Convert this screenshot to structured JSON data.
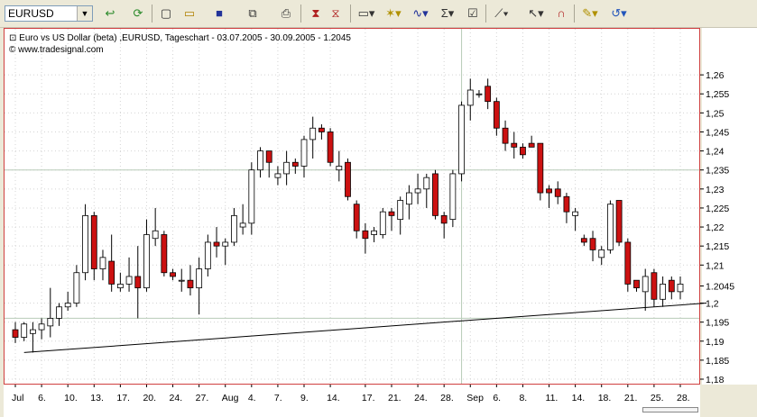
{
  "toolbar": {
    "symbol": "EURUSD",
    "buttons": [
      "go-icon",
      "refresh-icon",
      "new-icon",
      "open-icon",
      "save-icon",
      "copy-icon",
      "print-icon",
      "chart-icon",
      "chart2-icon",
      "window-icon",
      "indicator-icon",
      "study-icon",
      "sum-icon",
      "properties-icon",
      "draw-line-icon",
      "cursor-icon",
      "magnet-icon",
      "note-icon",
      "undo-icon"
    ]
  },
  "header": {
    "line1": "Euro vs US Dollar (beta) ,EURUSD, Tageschart - 03.07.2005 - 30.09.2005 - 1.2045",
    "line2": "www.tradesignal.com"
  },
  "colors": {
    "up": "#ffffff",
    "down": "#cc1111",
    "grid": "#c9c9c9",
    "frame": "#d04040"
  },
  "chart_data": {
    "type": "candlestick",
    "ylim": [
      1.18,
      1.265
    ],
    "yticks": [
      "1,26",
      "1,255",
      "1,25",
      "1,245",
      "1,24",
      "1,235",
      "1,23",
      "1,225",
      "1,22",
      "1,215",
      "1,21",
      "1.2045",
      "1,2",
      "1,195",
      "1,19",
      "1,185",
      "1,18"
    ],
    "xticks": [
      "Jul",
      "6.",
      "10.",
      "13.",
      "17.",
      "20.",
      "24.",
      "27.",
      "Aug",
      "4.",
      "7.",
      "9.",
      "14.",
      "17.",
      "21.",
      "24.",
      "28.",
      "Sep",
      "6.",
      "8.",
      "11.",
      "14.",
      "18.",
      "21.",
      "25.",
      "28."
    ],
    "last_value": "1.2045",
    "candles": [
      [
        1.193,
        1.195,
        1.1895,
        1.191
      ],
      [
        1.191,
        1.195,
        1.19,
        1.1945
      ],
      [
        1.192,
        1.195,
        1.187,
        1.193
      ],
      [
        1.193,
        1.196,
        1.1905,
        1.1945
      ],
      [
        1.194,
        1.204,
        1.191,
        1.196
      ],
      [
        1.196,
        1.2,
        1.194,
        1.199
      ],
      [
        1.199,
        1.203,
        1.198,
        1.2
      ],
      [
        1.2,
        1.21,
        1.199,
        1.208
      ],
      [
        1.208,
        1.226,
        1.206,
        1.223
      ],
      [
        1.223,
        1.224,
        1.206,
        1.209
      ],
      [
        1.209,
        1.214,
        1.206,
        1.212
      ],
      [
        1.211,
        1.218,
        1.203,
        1.205
      ],
      [
        1.204,
        1.208,
        1.203,
        1.205
      ],
      [
        1.205,
        1.212,
        1.203,
        1.207
      ],
      [
        1.207,
        1.215,
        1.196,
        1.204
      ],
      [
        1.204,
        1.222,
        1.203,
        1.218
      ],
      [
        1.217,
        1.225,
        1.215,
        1.219
      ],
      [
        1.218,
        1.219,
        1.207,
        1.208
      ],
      [
        1.208,
        1.209,
        1.206,
        1.207
      ],
      [
        1.206,
        1.209,
        1.203,
        1.206
      ],
      [
        1.206,
        1.21,
        1.202,
        1.204
      ],
      [
        1.204,
        1.212,
        1.197,
        1.209
      ],
      [
        1.209,
        1.218,
        1.207,
        1.216
      ],
      [
        1.216,
        1.22,
        1.212,
        1.215
      ],
      [
        1.215,
        1.217,
        1.21,
        1.216
      ],
      [
        1.216,
        1.225,
        1.215,
        1.223
      ],
      [
        1.22,
        1.226,
        1.218,
        1.221
      ],
      [
        1.221,
        1.237,
        1.218,
        1.235
      ],
      [
        1.235,
        1.241,
        1.233,
        1.24
      ],
      [
        1.24,
        1.24,
        1.233,
        1.237
      ],
      [
        1.233,
        1.236,
        1.231,
        1.234
      ],
      [
        1.234,
        1.24,
        1.231,
        1.237
      ],
      [
        1.237,
        1.238,
        1.234,
        1.236
      ],
      [
        1.236,
        1.244,
        1.233,
        1.243
      ],
      [
        1.243,
        1.249,
        1.238,
        1.246
      ],
      [
        1.246,
        1.247,
        1.243,
        1.245
      ],
      [
        1.245,
        1.246,
        1.236,
        1.237
      ],
      [
        1.235,
        1.24,
        1.232,
        1.236
      ],
      [
        1.237,
        1.238,
        1.227,
        1.228
      ],
      [
        1.226,
        1.227,
        1.217,
        1.219
      ],
      [
        1.219,
        1.221,
        1.213,
        1.217
      ],
      [
        1.218,
        1.22,
        1.216,
        1.219
      ],
      [
        1.218,
        1.225,
        1.217,
        1.224
      ],
      [
        1.224,
        1.225,
        1.219,
        1.223
      ],
      [
        1.222,
        1.228,
        1.218,
        1.227
      ],
      [
        1.226,
        1.231,
        1.222,
        1.229
      ],
      [
        1.229,
        1.234,
        1.226,
        1.23
      ],
      [
        1.23,
        1.234,
        1.225,
        1.233
      ],
      [
        1.234,
        1.235,
        1.222,
        1.223
      ],
      [
        1.223,
        1.224,
        1.217,
        1.221
      ],
      [
        1.222,
        1.235,
        1.22,
        1.234
      ],
      [
        1.234,
        1.253,
        1.232,
        1.252
      ],
      [
        1.252,
        1.259,
        1.248,
        1.256
      ],
      [
        1.255,
        1.256,
        1.254,
        1.255
      ],
      [
        1.257,
        1.259,
        1.251,
        1.253
      ],
      [
        1.253,
        1.254,
        1.244,
        1.246
      ],
      [
        1.246,
        1.248,
        1.24,
        1.242
      ],
      [
        1.242,
        1.245,
        1.238,
        1.241
      ],
      [
        1.241,
        1.242,
        1.238,
        1.239
      ],
      [
        1.242,
        1.244,
        1.241,
        1.241
      ],
      [
        1.242,
        1.242,
        1.227,
        1.229
      ],
      [
        1.23,
        1.231,
        1.225,
        1.229
      ],
      [
        1.23,
        1.232,
        1.226,
        1.228
      ],
      [
        1.228,
        1.229,
        1.221,
        1.224
      ],
      [
        1.223,
        1.225,
        1.219,
        1.224
      ],
      [
        1.217,
        1.218,
        1.215,
        1.216
      ],
      [
        1.217,
        1.219,
        1.211,
        1.214
      ],
      [
        1.212,
        1.215,
        1.21,
        1.214
      ],
      [
        1.214,
        1.227,
        1.213,
        1.226
      ],
      [
        1.227,
        1.227,
        1.215,
        1.216
      ],
      [
        1.216,
        1.217,
        1.203,
        1.205
      ],
      [
        1.206,
        1.206,
        1.203,
        1.204
      ],
      [
        1.203,
        1.209,
        1.198,
        1.207
      ],
      [
        1.208,
        1.209,
        1.199,
        1.201
      ],
      [
        1.201,
        1.207,
        1.199,
        1.205
      ],
      [
        1.206,
        1.207,
        1.201,
        1.203
      ],
      [
        1.203,
        1.207,
        1.201,
        1.205
      ]
    ],
    "trendline": {
      "from": [
        1,
        1.187
      ],
      "to": [
        79,
        1.2
      ]
    },
    "hgrid_values": [
      1.235,
      1.196
    ],
    "vgrid_candle_index": 51
  }
}
